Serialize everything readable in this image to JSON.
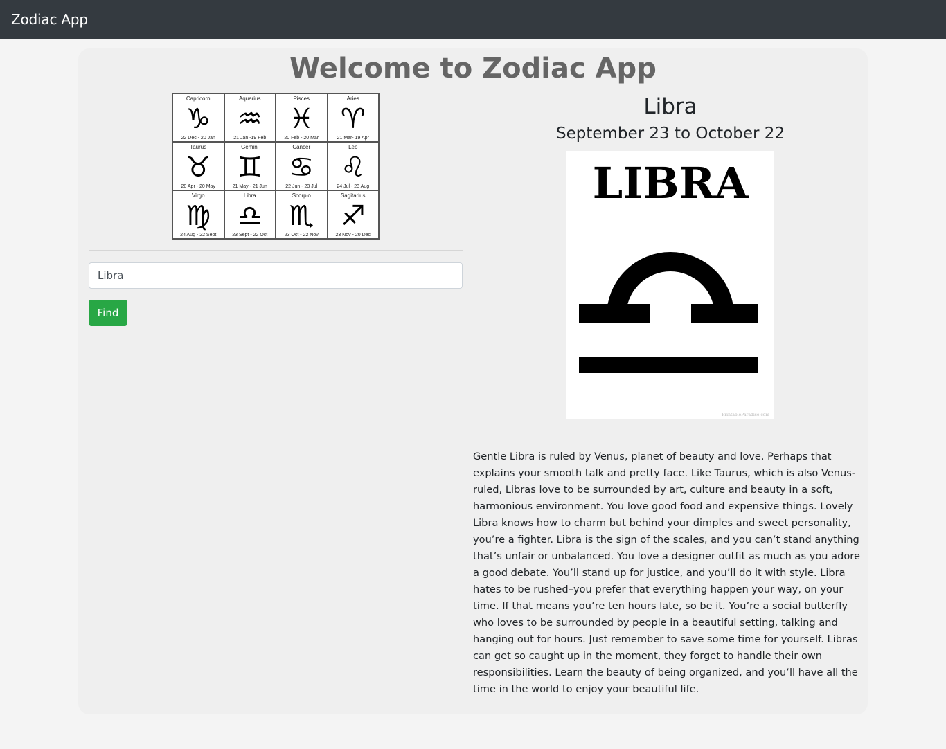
{
  "navbar": {
    "brand": "Zodiac App"
  },
  "main": {
    "title": "Welcome to Zodiac App"
  },
  "chart_grid": [
    {
      "name": "Capricorn",
      "symbol": "♑",
      "dates": "22 Dec - 20 Jan"
    },
    {
      "name": "Aquarius",
      "symbol": "♒",
      "dates": "21 Jan -19 Feb"
    },
    {
      "name": "Pisces",
      "symbol": "♓",
      "dates": "20 Feb - 20 Mar"
    },
    {
      "name": "Aries",
      "symbol": "♈",
      "dates": "21 Mar- 19 Apr"
    },
    {
      "name": "Taurus",
      "symbol": "♉",
      "dates": "20 Apr - 20 May"
    },
    {
      "name": "Gemini",
      "symbol": "♊",
      "dates": "21 May - 21 Jun"
    },
    {
      "name": "Cancer",
      "symbol": "♋",
      "dates": "22 Jun - 23 Jul"
    },
    {
      "name": "Leo",
      "symbol": "♌",
      "dates": "24 Jul - 23 Aug"
    },
    {
      "name": "Virgo",
      "symbol": "♍",
      "dates": "24 Aug - 22 Sept"
    },
    {
      "name": "Libra",
      "symbol": "♎",
      "dates": "23 Sept - 22 Oct"
    },
    {
      "name": "Scorpio",
      "symbol": "♏",
      "dates": "23 Oct - 22 Nov"
    },
    {
      "name": "Sagitarius",
      "symbol": "♐",
      "dates": "23 Nov - 20 Dec"
    }
  ],
  "search": {
    "value": "Libra",
    "button_label": "Find"
  },
  "result": {
    "sign": "Libra",
    "dates": "September 23 to October 22",
    "image_title": "LIBRA",
    "image_credit": "PrintableParadise.com",
    "description": "Gentle Libra is ruled by Venus, planet of beauty and love. Perhaps that explains your smooth talk and pretty face. Like Taurus, which is also Venus-ruled, Libras love to be surrounded by art, culture and beauty in a soft, harmonious environment. You love good food and expensive things. Lovely Libra knows how to charm but behind your dimples and sweet personality, you’re a fighter. Libra is the sign of the scales, and you can’t stand anything that’s unfair or unbalanced. You love a designer outfit as much as you adore a good debate. You’ll stand up for justice, and you’ll do it with style. Libra hates to be rushed–you prefer that everything happen your way, on your time. If that means you’re ten hours late, so be it. You’re a social butterfly who loves to be surrounded by people in a beautiful setting, talking and hanging out for hours. Just remember to save some time for yourself. Libras can get so caught up in the moment, they forget to handle their own responsibilities. Learn the beauty of being organized, and you’ll have all the time in the world to enjoy your beautiful life."
  }
}
